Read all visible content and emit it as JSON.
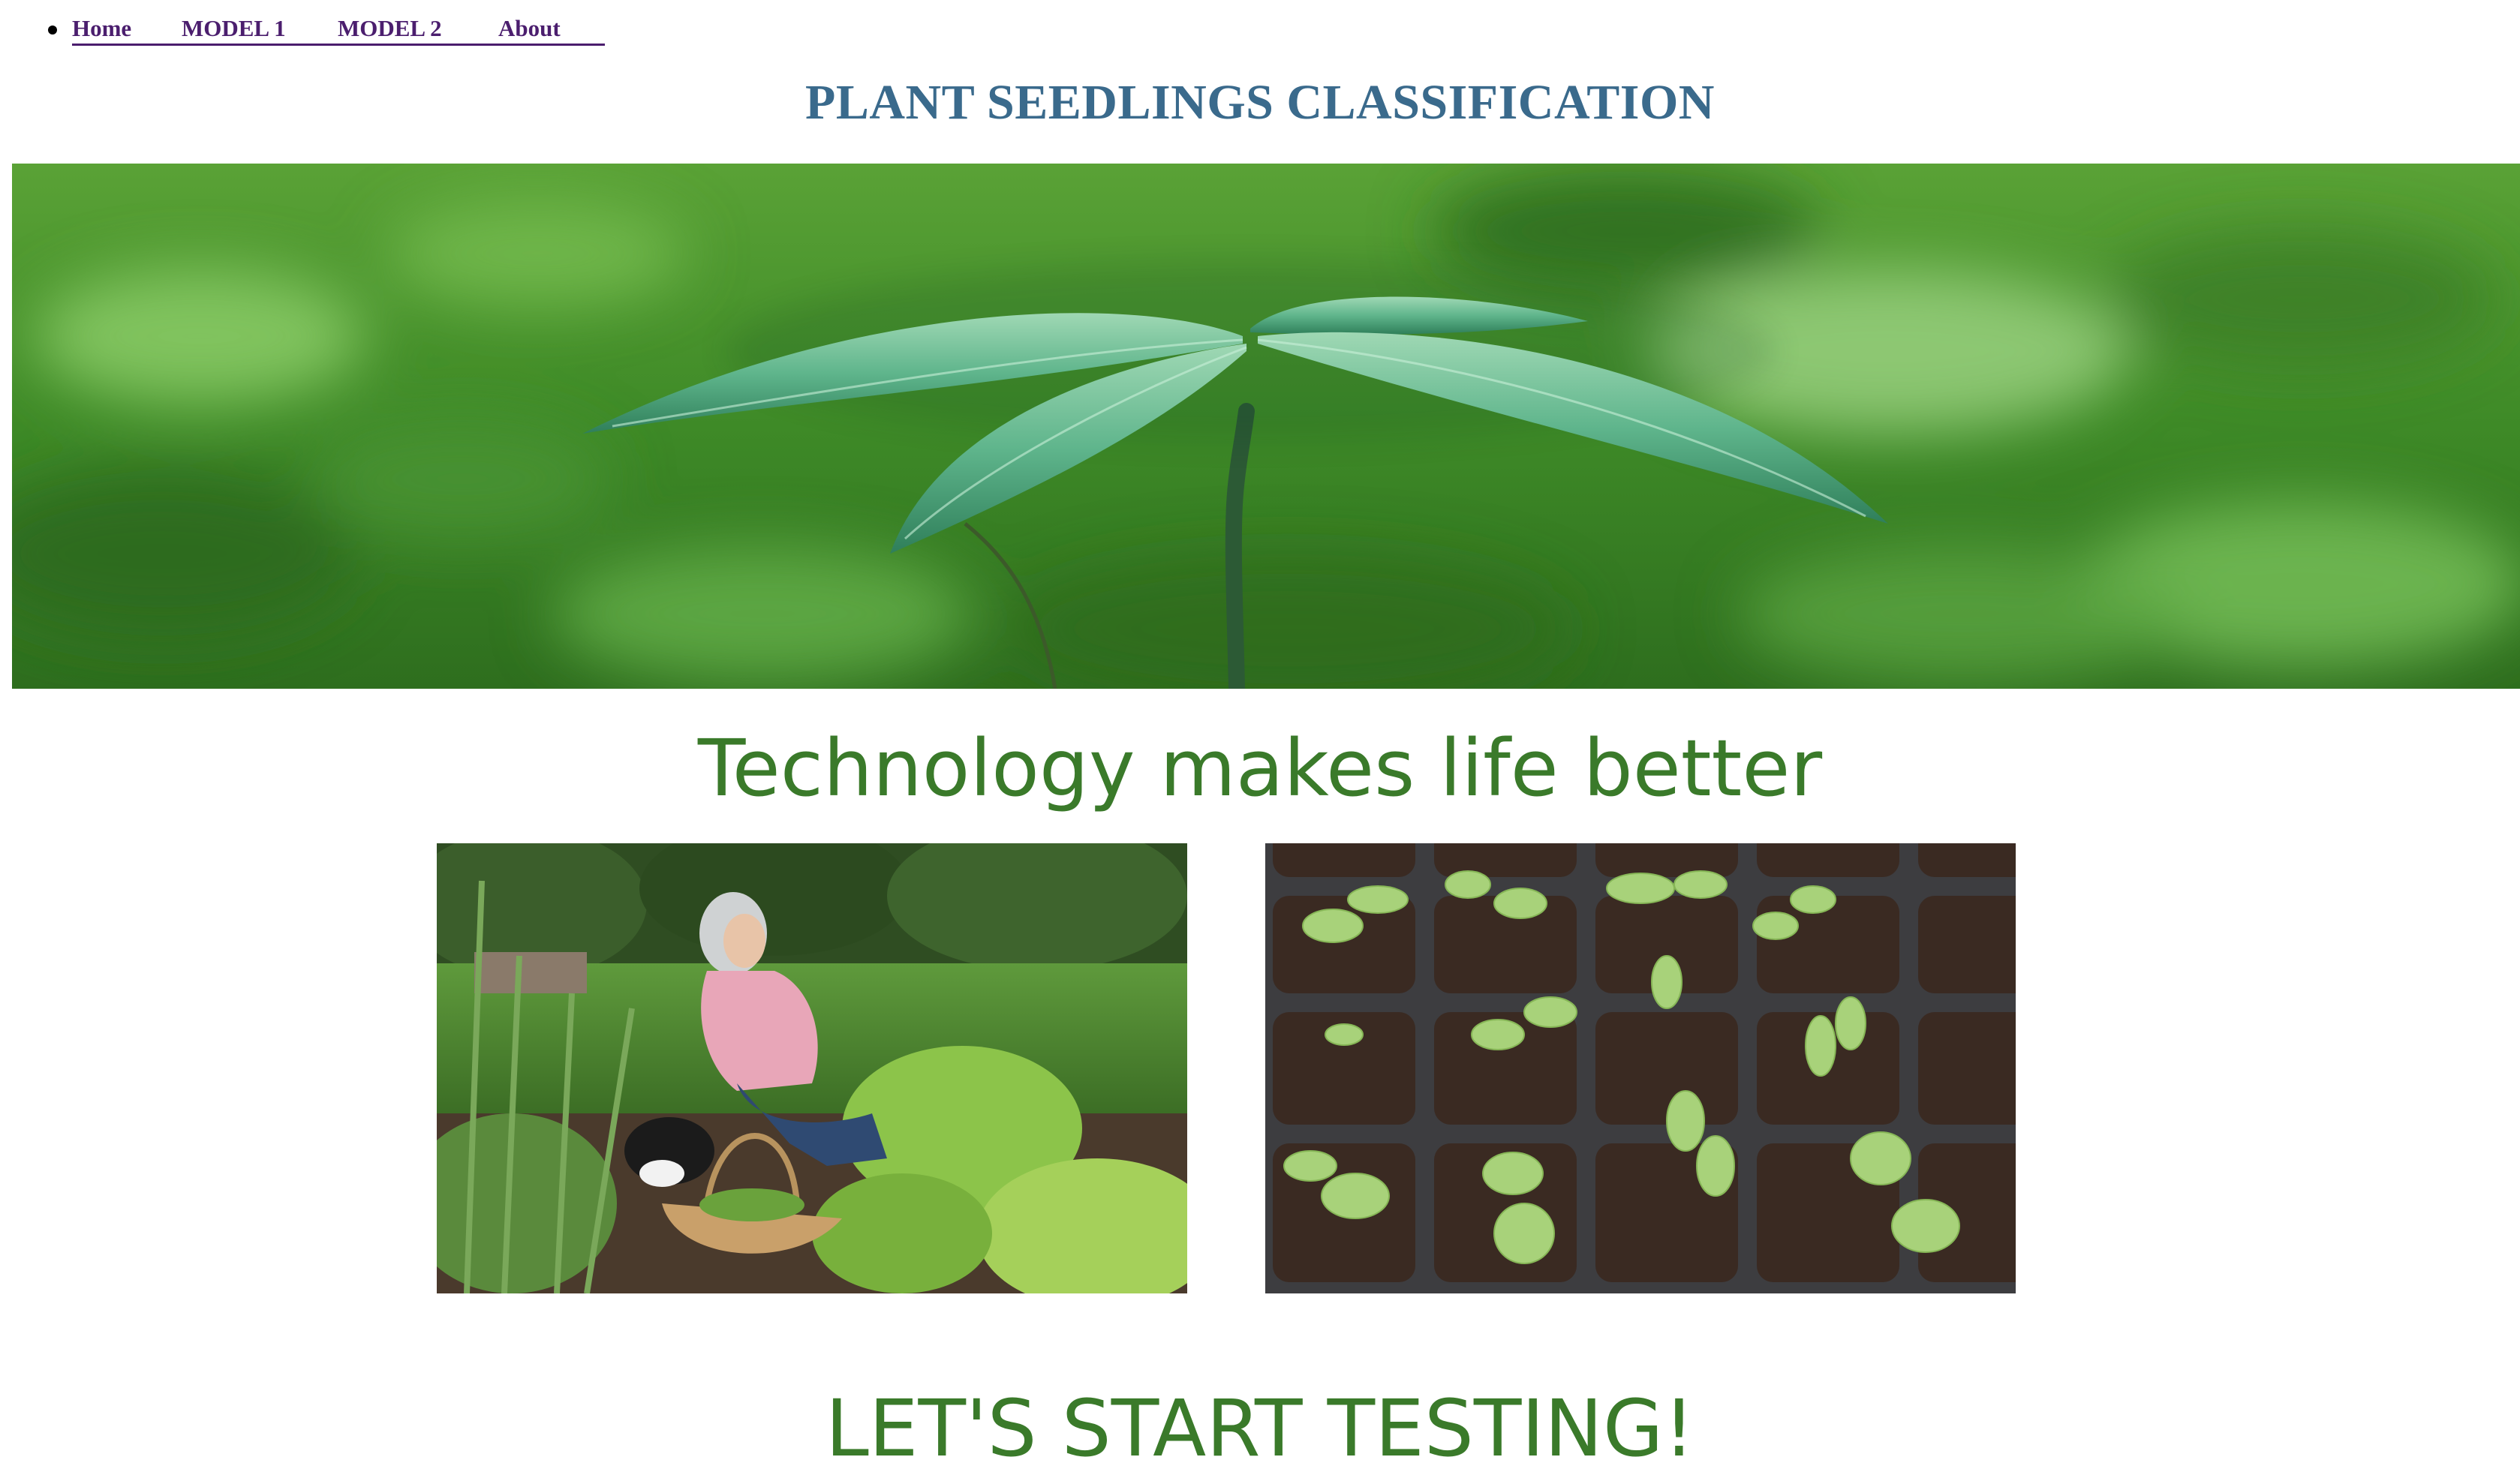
{
  "nav": {
    "items": [
      {
        "label": "Home"
      },
      {
        "label": "MODEL 1"
      },
      {
        "label": "MODEL 2"
      },
      {
        "label": "About"
      }
    ]
  },
  "header": {
    "title": "PLANT SEEDLINGS CLASSIFICATION"
  },
  "hero": {
    "image": "seedling-in-rain-photo"
  },
  "main": {
    "tagline": "Technology makes life better",
    "photos": [
      {
        "image": "woman-gardening-with-cat-photo"
      },
      {
        "image": "seedlings-in-trays-photo"
      }
    ],
    "cta": "LET'S START TESTING!"
  },
  "colors": {
    "title": "#3a6a8c",
    "green_text": "#3a7a2a",
    "link": "#4b1e6e"
  }
}
